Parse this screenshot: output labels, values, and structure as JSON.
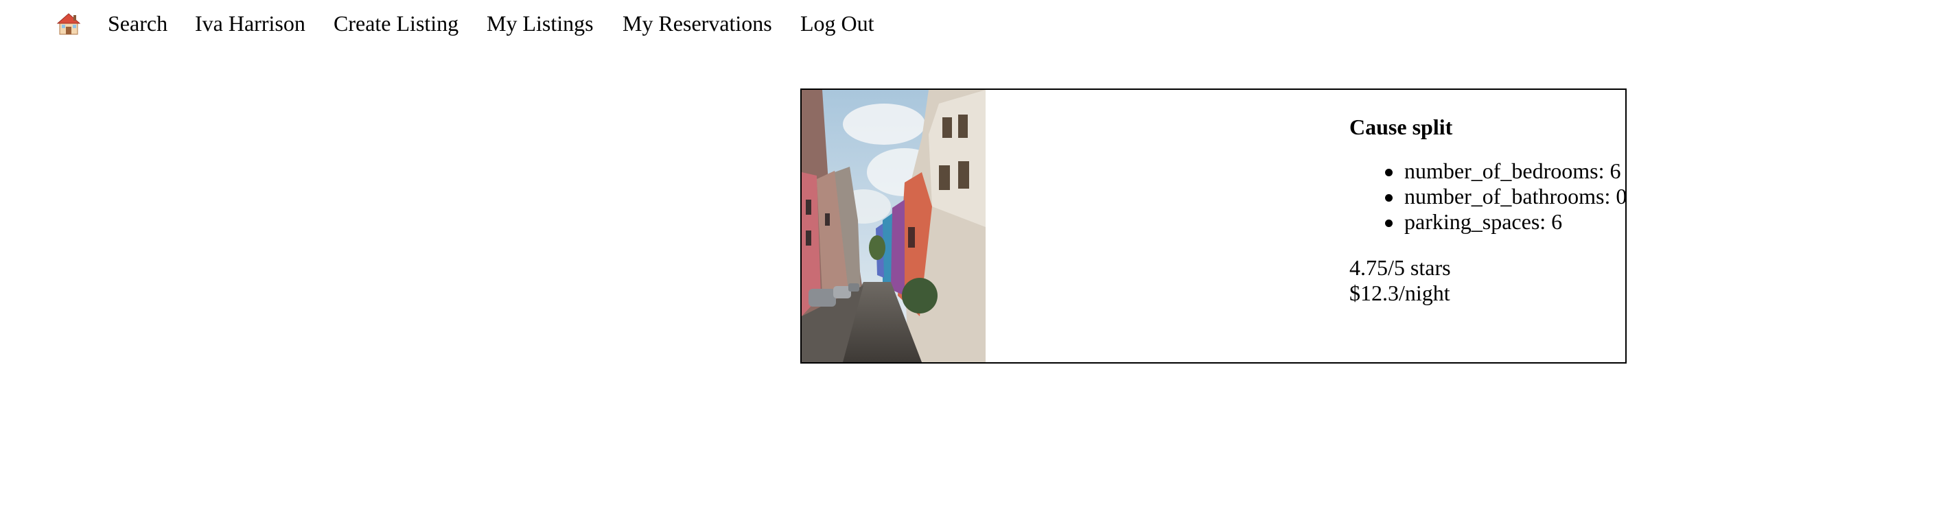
{
  "nav": {
    "home_icon": "house-icon",
    "items": [
      {
        "label": "Search"
      },
      {
        "label": "Iva Harrison"
      },
      {
        "label": "Create Listing"
      },
      {
        "label": "My Listings"
      },
      {
        "label": "My Reservations"
      },
      {
        "label": "Log Out"
      }
    ]
  },
  "listing": {
    "title": "Cause split",
    "photo_subject": "street-photo",
    "features": [
      {
        "key": "number_of_bedrooms",
        "value": "6",
        "text": "number_of_bedrooms: 6"
      },
      {
        "key": "number_of_bathrooms",
        "value": "0",
        "text": "number_of_bathrooms: 0"
      },
      {
        "key": "parking_spaces",
        "value": "6",
        "text": "parking_spaces: 6"
      }
    ],
    "rating": "4.75/5 stars",
    "price": "$12.3/night"
  }
}
